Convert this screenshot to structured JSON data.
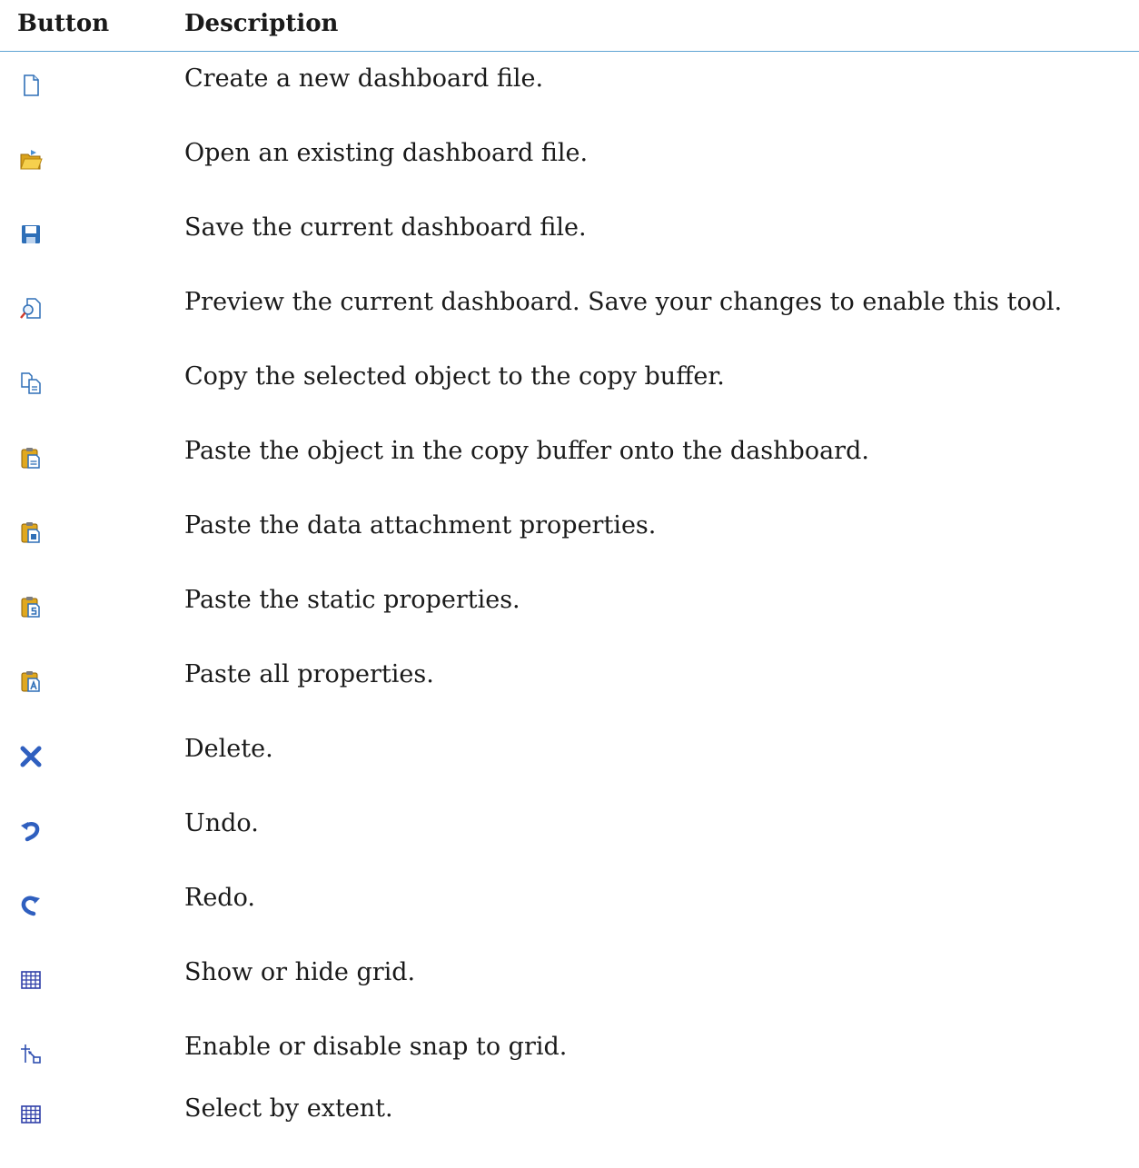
{
  "header": {
    "button": "Button",
    "description": "Description"
  },
  "rows": [
    {
      "icon": "new-file-icon",
      "description": "Create a new dashboard file."
    },
    {
      "icon": "open-folder-icon",
      "description": "Open an existing dashboard file."
    },
    {
      "icon": "save-icon",
      "description": "Save the current dashboard file."
    },
    {
      "icon": "preview-icon",
      "description": "Preview the current dashboard. Save your changes to enable this tool."
    },
    {
      "icon": "copy-icon",
      "description": "Copy the selected object to the copy buffer."
    },
    {
      "icon": "paste-icon",
      "description": "Paste the object in the copy buffer onto the dashboard."
    },
    {
      "icon": "paste-data-attachment-icon",
      "description": "Paste the data attachment properties."
    },
    {
      "icon": "paste-static-properties-icon",
      "description": "Paste the static properties."
    },
    {
      "icon": "paste-all-properties-icon",
      "description": "Paste all properties."
    },
    {
      "icon": "delete-icon",
      "description": "Delete."
    },
    {
      "icon": "undo-icon",
      "description": "Undo."
    },
    {
      "icon": "redo-icon",
      "description": "Redo."
    },
    {
      "icon": "grid-icon",
      "description": "Show or hide grid."
    },
    {
      "icon": "snap-to-grid-icon",
      "description": "Enable or disable snap to grid."
    },
    {
      "icon": "select-by-extent-icon",
      "description": "Select by extent."
    }
  ]
}
